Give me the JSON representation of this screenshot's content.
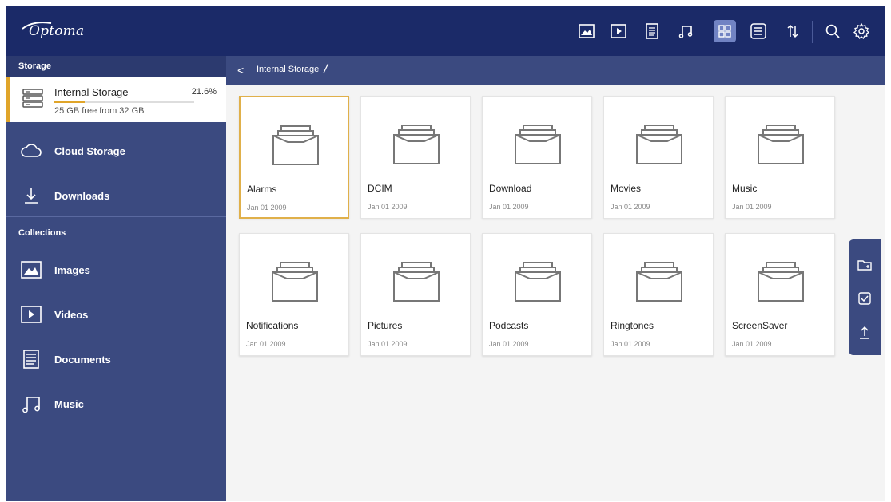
{
  "brand": {
    "name": "Optoma"
  },
  "toolbar": {
    "buttons": [
      {
        "icon": "image-icon",
        "active": false
      },
      {
        "icon": "video-icon",
        "active": false
      },
      {
        "icon": "document-icon",
        "active": false
      },
      {
        "icon": "music-icon",
        "active": false
      },
      {
        "icon": "grid-view-icon",
        "active": true
      },
      {
        "icon": "list-view-icon",
        "active": false
      },
      {
        "icon": "sort-icon",
        "active": false
      },
      {
        "icon": "search-icon",
        "active": false
      },
      {
        "icon": "settings-icon",
        "active": false
      }
    ]
  },
  "sidebar": {
    "storage_heading": "Storage",
    "internal_storage": {
      "name": "Internal Storage",
      "percent_label": "21.6%",
      "used_fraction": 0.216,
      "free_label": "25 GB free from 32 GB"
    },
    "storage_items": [
      {
        "label": "Cloud Storage",
        "icon": "cloud-icon"
      },
      {
        "label": "Downloads",
        "icon": "download-icon"
      }
    ],
    "collections_heading": "Collections",
    "collections": [
      {
        "label": "Images",
        "icon": "image-icon"
      },
      {
        "label": "Videos",
        "icon": "video-icon"
      },
      {
        "label": "Documents",
        "icon": "document-icon"
      },
      {
        "label": "Music",
        "icon": "music-icon"
      }
    ]
  },
  "breadcrumb": {
    "back": "<",
    "path": "Internal Storage",
    "separator": "/"
  },
  "folders": [
    {
      "name": "Alarms",
      "date": "Jan 01 2009",
      "selected": true
    },
    {
      "name": "DCIM",
      "date": "Jan 01 2009",
      "selected": false
    },
    {
      "name": "Download",
      "date": "Jan 01 2009",
      "selected": false
    },
    {
      "name": "Movies",
      "date": "Jan 01 2009",
      "selected": false
    },
    {
      "name": "Music",
      "date": "Jan 01 2009",
      "selected": false
    },
    {
      "name": "Notifications",
      "date": "Jan 01 2009",
      "selected": false
    },
    {
      "name": "Pictures",
      "date": "Jan 01 2009",
      "selected": false
    },
    {
      "name": "Podcasts",
      "date": "Jan 01 2009",
      "selected": false
    },
    {
      "name": "Ringtones",
      "date": "Jan 01 2009",
      "selected": false
    },
    {
      "name": "ScreenSaver",
      "date": "Jan 01 2009",
      "selected": false
    }
  ],
  "actions": [
    {
      "icon": "new-folder-icon"
    },
    {
      "icon": "select-icon"
    },
    {
      "icon": "upload-icon"
    }
  ],
  "colors": {
    "topbar": "#1b2a68",
    "sidebar": "#3b4a80",
    "accent": "#e0a52a",
    "active_tab": "#7183c3"
  }
}
